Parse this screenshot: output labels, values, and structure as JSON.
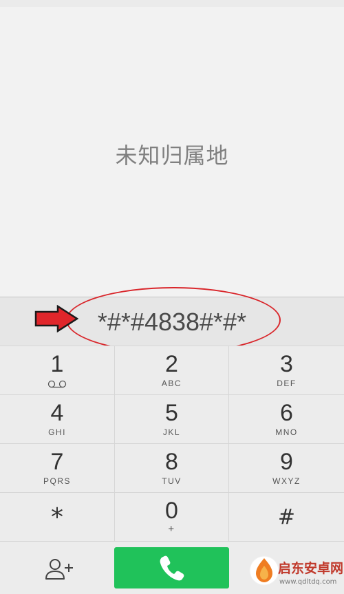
{
  "caller": {
    "location": "未知归属地"
  },
  "dialer": {
    "number": "*#*#4838#*#*"
  },
  "keypad": {
    "keys": [
      {
        "digit": "1",
        "letters": "",
        "icon": "voicemail-icon"
      },
      {
        "digit": "2",
        "letters": "ABC"
      },
      {
        "digit": "3",
        "letters": "DEF"
      },
      {
        "digit": "4",
        "letters": "GHI"
      },
      {
        "digit": "5",
        "letters": "JKL"
      },
      {
        "digit": "6",
        "letters": "MNO"
      },
      {
        "digit": "7",
        "letters": "PQRS"
      },
      {
        "digit": "8",
        "letters": "TUV"
      },
      {
        "digit": "9",
        "letters": "WXYZ"
      },
      {
        "digit": "*",
        "letters": ""
      },
      {
        "digit": "0",
        "letters": "+"
      },
      {
        "digit": "#",
        "letters": ""
      }
    ]
  },
  "bottom": {
    "add_contact_icon": "add-contact-icon",
    "call_icon": "phone-icon",
    "call_color": "#20c25a"
  },
  "annotation": {
    "highlight_color": "#d9262b",
    "arrow_icon": "right-arrow-icon"
  },
  "watermark": {
    "title": "启东安卓网",
    "url": "www.qdltdq.com"
  }
}
